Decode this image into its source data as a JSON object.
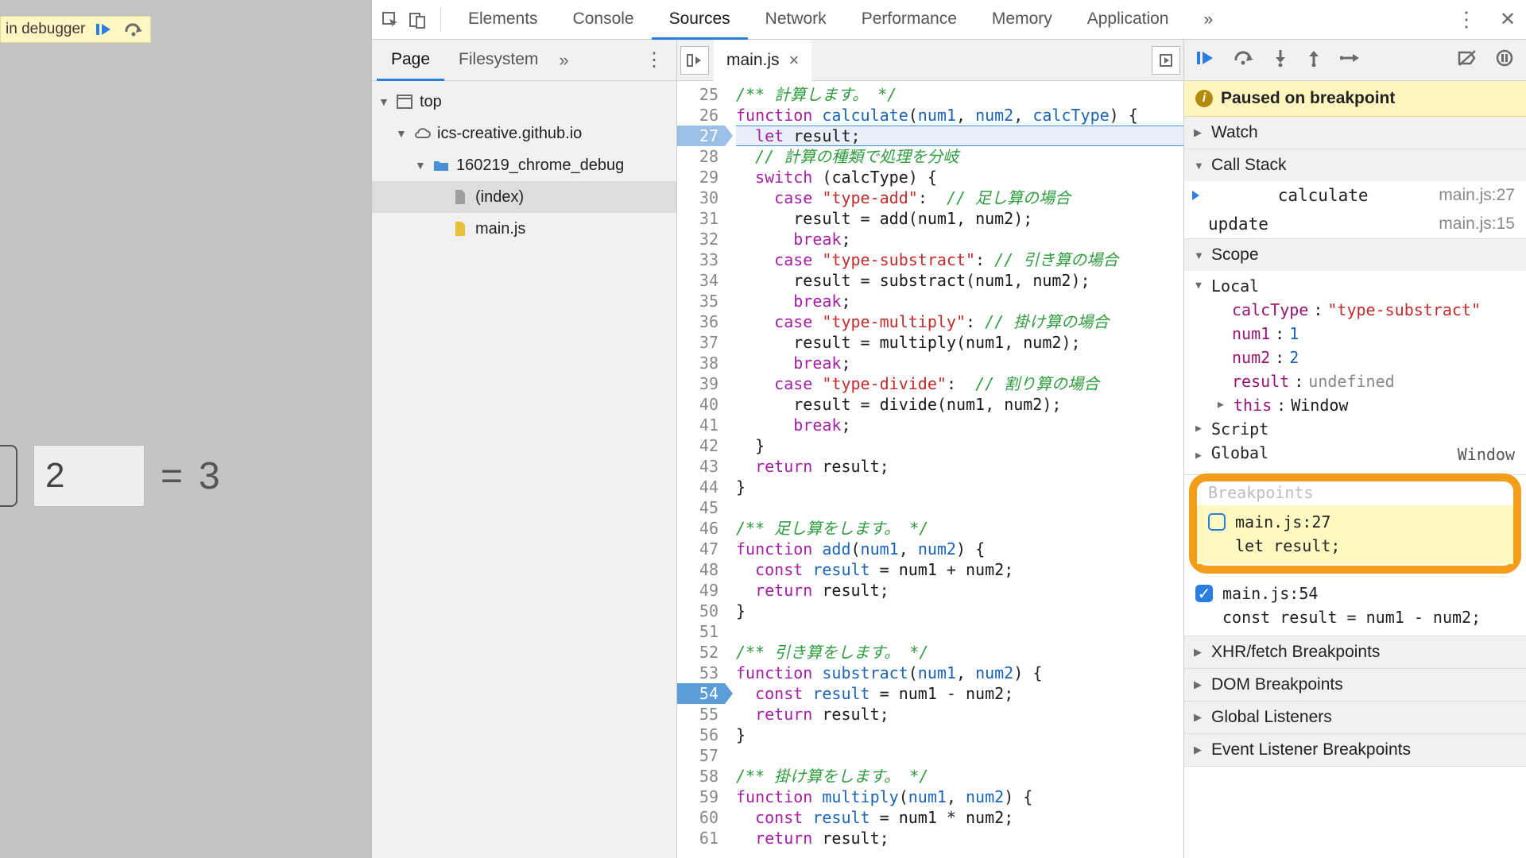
{
  "debugger_overlay": {
    "text": "in debugger"
  },
  "page": {
    "operand": "2",
    "equals": "=",
    "result": "3"
  },
  "tabs": {
    "items": [
      "Elements",
      "Console",
      "Sources",
      "Network",
      "Performance",
      "Memory",
      "Application"
    ],
    "active": 2,
    "more": "»"
  },
  "navigator": {
    "tabs": {
      "items": [
        "Page",
        "Filesystem"
      ],
      "active": 0,
      "more": "»"
    },
    "tree": {
      "top": "top",
      "origin": "ics-creative.github.io",
      "folder": "160219_chrome_debug",
      "files": [
        "(index)",
        "main.js"
      ],
      "selected": 0
    }
  },
  "editor": {
    "tab": {
      "name": "main.js"
    },
    "startLine": 25,
    "current": 27,
    "breakpoints": [
      27,
      54
    ],
    "lines": [
      {
        "n": 25,
        "seg": [
          [
            "com",
            "/** 計算します。 */"
          ]
        ]
      },
      {
        "n": 26,
        "seg": [
          [
            "kw",
            "function "
          ],
          [
            "def",
            "calculate"
          ],
          [
            "op",
            "("
          ],
          [
            "def",
            "num1"
          ],
          [
            "op",
            ", "
          ],
          [
            "def",
            "num2"
          ],
          [
            "op",
            ", "
          ],
          [
            "def",
            "calcType"
          ],
          [
            "op",
            ") {"
          ]
        ]
      },
      {
        "n": 27,
        "seg": [
          [
            "op",
            "  "
          ],
          [
            "kw",
            "let "
          ],
          [
            "ident",
            "result"
          ],
          [
            "op",
            ";"
          ]
        ],
        "hl": true
      },
      {
        "n": 28,
        "seg": [
          [
            "op",
            "  "
          ],
          [
            "com",
            "// 計算の種類で処理を分岐"
          ]
        ]
      },
      {
        "n": 29,
        "seg": [
          [
            "op",
            "  "
          ],
          [
            "kw",
            "switch"
          ],
          [
            "op",
            " ("
          ],
          [
            "ident",
            "calcType"
          ],
          [
            "op",
            ") {"
          ]
        ]
      },
      {
        "n": 30,
        "seg": [
          [
            "op",
            "    "
          ],
          [
            "kw",
            "case "
          ],
          [
            "str",
            "\"type-add\""
          ],
          [
            "op",
            ":  "
          ],
          [
            "com",
            "// 足し算の場合"
          ]
        ]
      },
      {
        "n": 31,
        "seg": [
          [
            "op",
            "      "
          ],
          [
            "ident",
            "result"
          ],
          [
            "op",
            " = "
          ],
          [
            "ident",
            "add"
          ],
          [
            "op",
            "("
          ],
          [
            "ident",
            "num1"
          ],
          [
            "op",
            ", "
          ],
          [
            "ident",
            "num2"
          ],
          [
            "op",
            ");"
          ]
        ]
      },
      {
        "n": 32,
        "seg": [
          [
            "op",
            "      "
          ],
          [
            "kw",
            "break"
          ],
          [
            "op",
            ";"
          ]
        ]
      },
      {
        "n": 33,
        "seg": [
          [
            "op",
            "    "
          ],
          [
            "kw",
            "case "
          ],
          [
            "str",
            "\"type-substract\""
          ],
          [
            "op",
            ": "
          ],
          [
            "com",
            "// 引き算の場合"
          ]
        ]
      },
      {
        "n": 34,
        "seg": [
          [
            "op",
            "      "
          ],
          [
            "ident",
            "result"
          ],
          [
            "op",
            " = "
          ],
          [
            "ident",
            "substract"
          ],
          [
            "op",
            "("
          ],
          [
            "ident",
            "num1"
          ],
          [
            "op",
            ", "
          ],
          [
            "ident",
            "num2"
          ],
          [
            "op",
            ");"
          ]
        ]
      },
      {
        "n": 35,
        "seg": [
          [
            "op",
            "      "
          ],
          [
            "kw",
            "break"
          ],
          [
            "op",
            ";"
          ]
        ]
      },
      {
        "n": 36,
        "seg": [
          [
            "op",
            "    "
          ],
          [
            "kw",
            "case "
          ],
          [
            "str",
            "\"type-multiply\""
          ],
          [
            "op",
            ": "
          ],
          [
            "com",
            "// 掛け算の場合"
          ]
        ]
      },
      {
        "n": 37,
        "seg": [
          [
            "op",
            "      "
          ],
          [
            "ident",
            "result"
          ],
          [
            "op",
            " = "
          ],
          [
            "ident",
            "multiply"
          ],
          [
            "op",
            "("
          ],
          [
            "ident",
            "num1"
          ],
          [
            "op",
            ", "
          ],
          [
            "ident",
            "num2"
          ],
          [
            "op",
            ");"
          ]
        ]
      },
      {
        "n": 38,
        "seg": [
          [
            "op",
            "      "
          ],
          [
            "kw",
            "break"
          ],
          [
            "op",
            ";"
          ]
        ]
      },
      {
        "n": 39,
        "seg": [
          [
            "op",
            "    "
          ],
          [
            "kw",
            "case "
          ],
          [
            "str",
            "\"type-divide\""
          ],
          [
            "op",
            ":  "
          ],
          [
            "com",
            "// 割り算の場合"
          ]
        ]
      },
      {
        "n": 40,
        "seg": [
          [
            "op",
            "      "
          ],
          [
            "ident",
            "result"
          ],
          [
            "op",
            " = "
          ],
          [
            "ident",
            "divide"
          ],
          [
            "op",
            "("
          ],
          [
            "ident",
            "num1"
          ],
          [
            "op",
            ", "
          ],
          [
            "ident",
            "num2"
          ],
          [
            "op",
            ");"
          ]
        ]
      },
      {
        "n": 41,
        "seg": [
          [
            "op",
            "      "
          ],
          [
            "kw",
            "break"
          ],
          [
            "op",
            ";"
          ]
        ]
      },
      {
        "n": 42,
        "seg": [
          [
            "op",
            "  }"
          ]
        ]
      },
      {
        "n": 43,
        "seg": [
          [
            "op",
            "  "
          ],
          [
            "kw",
            "return "
          ],
          [
            "ident",
            "result"
          ],
          [
            "op",
            ";"
          ]
        ]
      },
      {
        "n": 44,
        "seg": [
          [
            "op",
            "}"
          ]
        ]
      },
      {
        "n": 45,
        "seg": [
          [
            "op",
            ""
          ]
        ]
      },
      {
        "n": 46,
        "seg": [
          [
            "com",
            "/** 足し算をします。 */"
          ]
        ]
      },
      {
        "n": 47,
        "seg": [
          [
            "kw",
            "function "
          ],
          [
            "def",
            "add"
          ],
          [
            "op",
            "("
          ],
          [
            "def",
            "num1"
          ],
          [
            "op",
            ", "
          ],
          [
            "def",
            "num2"
          ],
          [
            "op",
            ") {"
          ]
        ]
      },
      {
        "n": 48,
        "seg": [
          [
            "op",
            "  "
          ],
          [
            "kw",
            "const "
          ],
          [
            "def",
            "result"
          ],
          [
            "op",
            " = "
          ],
          [
            "ident",
            "num1"
          ],
          [
            "op",
            " + "
          ],
          [
            "ident",
            "num2"
          ],
          [
            "op",
            ";"
          ]
        ]
      },
      {
        "n": 49,
        "seg": [
          [
            "op",
            "  "
          ],
          [
            "kw",
            "return "
          ],
          [
            "ident",
            "result"
          ],
          [
            "op",
            ";"
          ]
        ]
      },
      {
        "n": 50,
        "seg": [
          [
            "op",
            "}"
          ]
        ]
      },
      {
        "n": 51,
        "seg": [
          [
            "op",
            ""
          ]
        ]
      },
      {
        "n": 52,
        "seg": [
          [
            "com",
            "/** 引き算をします。 */"
          ]
        ]
      },
      {
        "n": 53,
        "seg": [
          [
            "kw",
            "function "
          ],
          [
            "def",
            "substract"
          ],
          [
            "op",
            "("
          ],
          [
            "def",
            "num1"
          ],
          [
            "op",
            ", "
          ],
          [
            "def",
            "num2"
          ],
          [
            "op",
            ") {"
          ]
        ]
      },
      {
        "n": 54,
        "seg": [
          [
            "op",
            "  "
          ],
          [
            "kw",
            "const "
          ],
          [
            "def",
            "result"
          ],
          [
            "op",
            " = "
          ],
          [
            "ident",
            "num1"
          ],
          [
            "op",
            " - "
          ],
          [
            "ident",
            "num2"
          ],
          [
            "op",
            ";"
          ]
        ]
      },
      {
        "n": 55,
        "seg": [
          [
            "op",
            "  "
          ],
          [
            "kw",
            "return "
          ],
          [
            "ident",
            "result"
          ],
          [
            "op",
            ";"
          ]
        ]
      },
      {
        "n": 56,
        "seg": [
          [
            "op",
            "}"
          ]
        ]
      },
      {
        "n": 57,
        "seg": [
          [
            "op",
            ""
          ]
        ]
      },
      {
        "n": 58,
        "seg": [
          [
            "com",
            "/** 掛け算をします。 */"
          ]
        ]
      },
      {
        "n": 59,
        "seg": [
          [
            "kw",
            "function "
          ],
          [
            "def",
            "multiply"
          ],
          [
            "op",
            "("
          ],
          [
            "def",
            "num1"
          ],
          [
            "op",
            ", "
          ],
          [
            "def",
            "num2"
          ],
          [
            "op",
            ") {"
          ]
        ]
      },
      {
        "n": 60,
        "seg": [
          [
            "op",
            "  "
          ],
          [
            "kw",
            "const "
          ],
          [
            "def",
            "result"
          ],
          [
            "op",
            " = "
          ],
          [
            "ident",
            "num1"
          ],
          [
            "op",
            " * "
          ],
          [
            "ident",
            "num2"
          ],
          [
            "op",
            ";"
          ]
        ]
      },
      {
        "n": 61,
        "seg": [
          [
            "op",
            "  "
          ],
          [
            "kw",
            "return "
          ],
          [
            "ident",
            "result"
          ],
          [
            "op",
            ";"
          ]
        ]
      }
    ]
  },
  "debug": {
    "paused": "Paused on breakpoint",
    "sections": {
      "watch": "Watch",
      "callstack": "Call Stack",
      "scope": "Scope",
      "breakpoints": "Breakpoints",
      "xhr": "XHR/fetch Breakpoints",
      "dom": "DOM Breakpoints",
      "listeners": "Global Listeners",
      "evl": "Event Listener Breakpoints"
    },
    "callstack": [
      {
        "fn": "calculate",
        "loc": "main.js:27",
        "current": true
      },
      {
        "fn": "update",
        "loc": "main.js:15",
        "current": false
      }
    ],
    "scope": {
      "local": "Local",
      "vars": [
        {
          "k": "calcType",
          "v": "\"type-substract\"",
          "cls": "v"
        },
        {
          "k": "num1",
          "v": "1",
          "cls": "vn"
        },
        {
          "k": "num2",
          "v": "2",
          "cls": "vn"
        },
        {
          "k": "result",
          "v": "undefined",
          "cls": "vg"
        },
        {
          "k": "this",
          "v": "Window",
          "cls": "ident",
          "arrow": true
        }
      ],
      "script": "Script",
      "global": {
        "label": "Global",
        "value": "Window"
      }
    },
    "breakpoints": [
      {
        "label": "main.js:27",
        "code": "let result;",
        "checked": false,
        "highlight": true
      },
      {
        "label": "main.js:54",
        "code": "const result = num1 - num2;",
        "checked": true,
        "highlight": false
      }
    ],
    "obscured": "Breakpoints"
  }
}
